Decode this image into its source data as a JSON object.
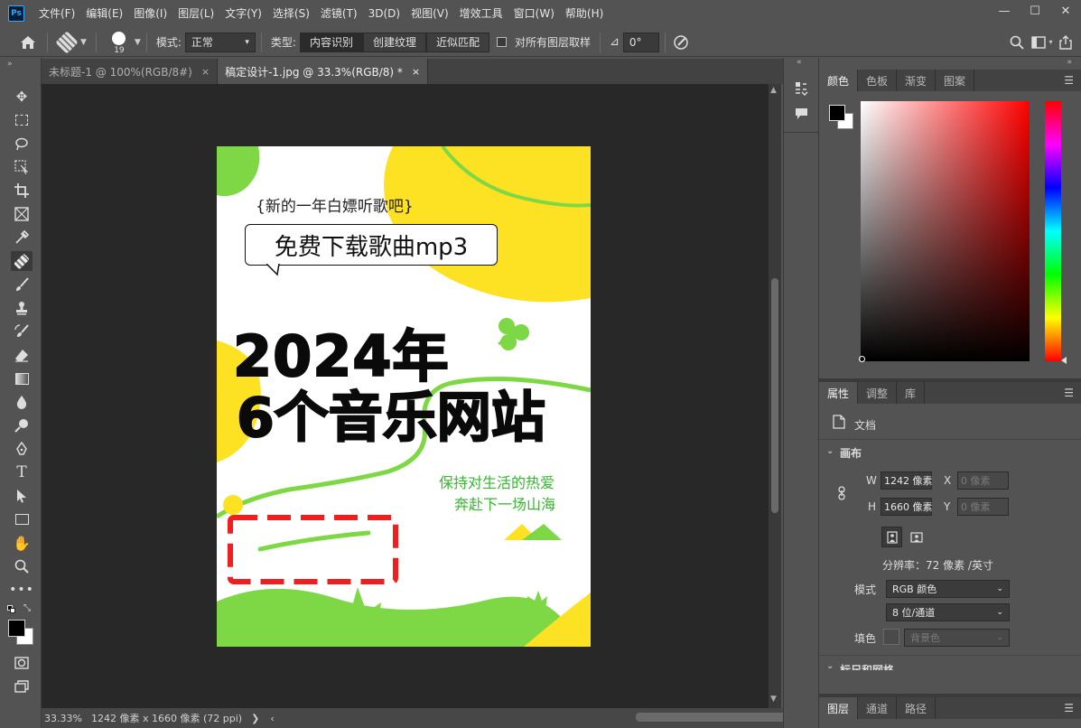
{
  "app": {
    "logo": "Ps"
  },
  "menu": [
    "文件(F)",
    "编辑(E)",
    "图像(I)",
    "图层(L)",
    "文字(Y)",
    "选择(S)",
    "滤镜(T)",
    "3D(D)",
    "视图(V)",
    "增效工具",
    "窗口(W)",
    "帮助(H)"
  ],
  "window": {
    "minimize": "—",
    "maximize": "☐",
    "close": "✕"
  },
  "options": {
    "brush_size": "19",
    "mode_label": "模式:",
    "mode_value": "正常",
    "type_label": "类型:",
    "type_buttons": [
      "内容识别",
      "创建纹理",
      "近似匹配"
    ],
    "sample_all": "对所有图层取样",
    "angle_value": "0°"
  },
  "tabs": [
    {
      "label": "未标题-1 @ 100%(RGB/8#)",
      "close": "×"
    },
    {
      "label": "稿定设计-1.jpg @ 33.3%(RGB/8) *",
      "close": "×"
    }
  ],
  "poster": {
    "top_text": "{新的一年白嫖听歌吧}",
    "bubble_text": "免费下载歌曲mp3",
    "headline1": "2024年",
    "headline2": "6个音乐网站",
    "slogan1": "保持对生活的热爱",
    "slogan2": "奔赴下一场山海",
    "colors": {
      "yellow": "#fde223",
      "green": "#7ed845",
      "selection": "#f01e1e",
      "slogan": "#38b531"
    }
  },
  "status": {
    "zoom": "33.33%",
    "doc_info": "1242 像素 x 1660 像素 (72 ppi)",
    "arrow": "❯",
    "left_arrow": "‹",
    "right_arrow": "›"
  },
  "color_panel": {
    "tabs": [
      "颜色",
      "色板",
      "渐变",
      "图案"
    ],
    "foreground": "#000000",
    "background": "#ffffff",
    "hue": "#ff0000"
  },
  "properties": {
    "tabs": [
      "属性",
      "调整",
      "库"
    ],
    "doc_label": "文档",
    "canvas_section": "画布",
    "w_label": "W",
    "w_value": "1242 像素",
    "h_label": "H",
    "h_value": "1660 像素",
    "x_label": "X",
    "x_value": "0 像素",
    "y_label": "Y",
    "y_value": "0 像素",
    "resolution": "分辨率：72 像素 /英寸",
    "mode_label": "模式",
    "mode_value": "RGB 颜色",
    "depth_value": "8 位/通道",
    "fill_label": "填色",
    "fill_value": "背景色",
    "rulers_section": "标尺和网格"
  },
  "layers_panel": {
    "tabs": [
      "图层",
      "通道",
      "路径"
    ]
  },
  "toolbar_tools": [
    "move-icon",
    "marquee-icon",
    "lasso-icon",
    "object-select-icon",
    "crop-icon",
    "frame-icon",
    "eyedropper-icon",
    "healing-brush-icon",
    "brush-icon",
    "stamp-icon",
    "history-brush-icon",
    "eraser-icon",
    "gradient-icon",
    "blur-icon",
    "dodge-icon",
    "pen-icon",
    "type-icon",
    "path-select-icon",
    "rectangle-icon",
    "hand-icon",
    "zoom-icon",
    "more-icon"
  ]
}
